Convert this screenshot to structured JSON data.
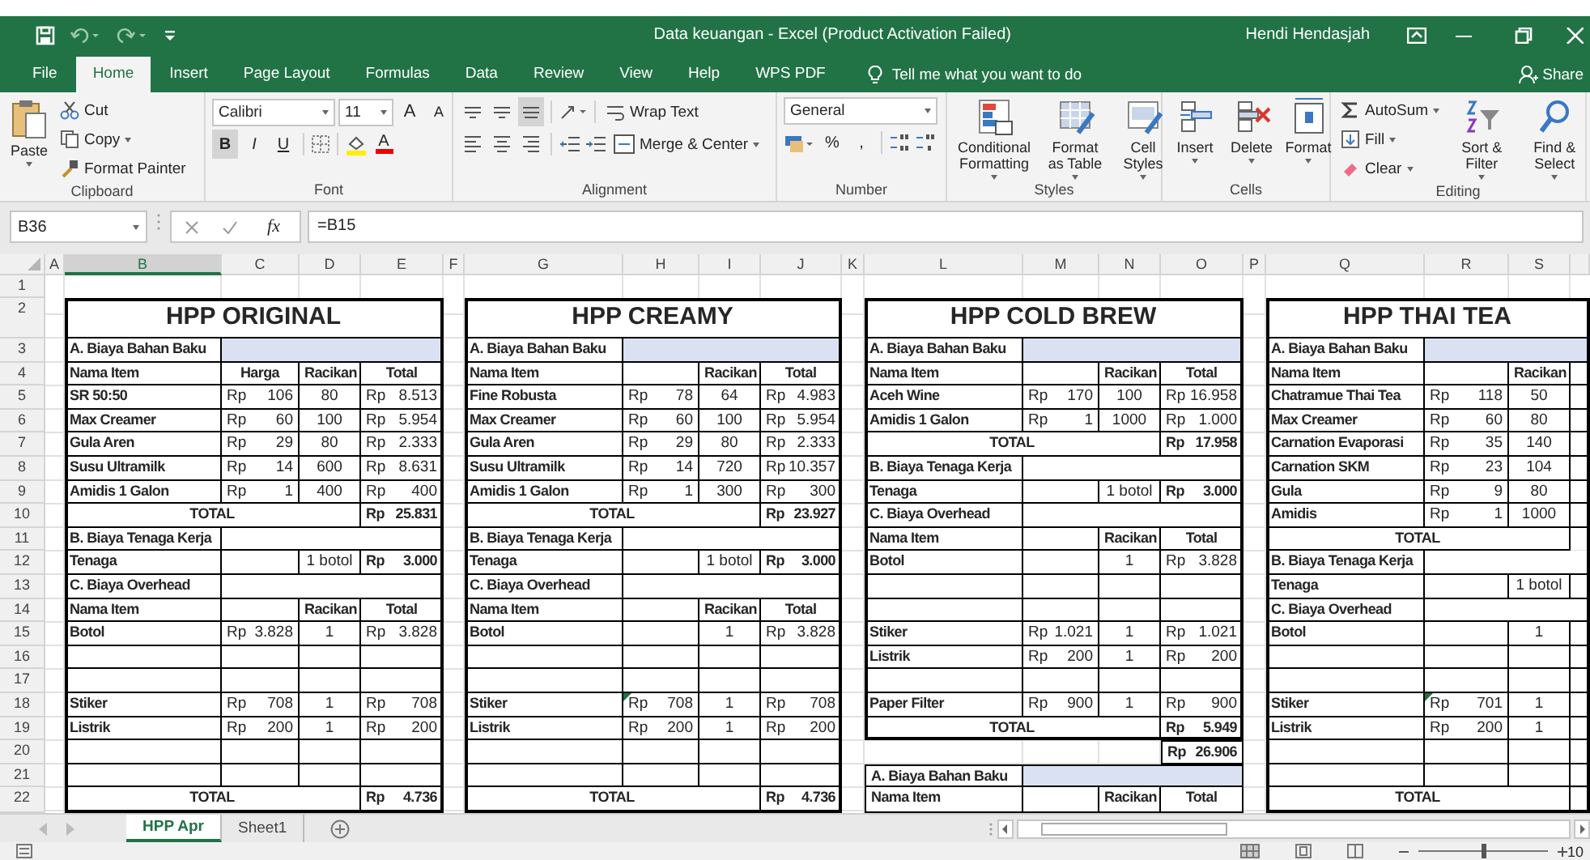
{
  "window": {
    "title": "Data keuangan - Excel (Product Activation Failed)",
    "user": "Hendi Hendasjah"
  },
  "tabs": [
    {
      "label": "File",
      "selected": false
    },
    {
      "label": "Home",
      "selected": true
    },
    {
      "label": "Insert",
      "selected": false
    },
    {
      "label": "Page Layout",
      "selected": false
    },
    {
      "label": "Formulas",
      "selected": false
    },
    {
      "label": "Data",
      "selected": false
    },
    {
      "label": "Review",
      "selected": false
    },
    {
      "label": "View",
      "selected": false
    },
    {
      "label": "Help",
      "selected": false
    },
    {
      "label": "WPS PDF",
      "selected": false
    }
  ],
  "tell_me": "Tell me what you want to do",
  "share": "Share",
  "ribbon": [
    {
      "kind": "clipboard",
      "label": "Clipboard",
      "paste": "Paste",
      "items": [
        "Cut",
        "Copy",
        "Format Painter"
      ]
    },
    {
      "kind": "font",
      "label": "Font",
      "font": "Calibri",
      "size": "11",
      "grow": [
        "A",
        "A"
      ],
      "styles": [
        {
          "label": "B",
          "selected": true
        },
        {
          "label": "I",
          "selected": false
        },
        {
          "label": "U",
          "selected": false
        }
      ],
      "color_label": "A"
    },
    {
      "kind": "alignment",
      "label": "Alignment",
      "aligns": [
        {
          "kind": "top",
          "selected": false
        },
        {
          "kind": "middle",
          "selected": false
        },
        {
          "kind": "bottom",
          "selected": true
        },
        {
          "kind": "left",
          "selected": false
        },
        {
          "kind": "center",
          "selected": false
        },
        {
          "kind": "right",
          "selected": false
        }
      ],
      "items": [
        "Wrap Text",
        "Merge & Center"
      ]
    },
    {
      "kind": "number",
      "label": "Number",
      "format": "General",
      "symbols": [
        "%",
        ","
      ]
    },
    {
      "kind": "styles",
      "label": "Styles",
      "items": [
        "Conditional Formatting",
        "Format as Table",
        "Cell Styles"
      ]
    },
    {
      "kind": "cells",
      "label": "Cells",
      "items": [
        "Insert",
        "Delete",
        "Format"
      ]
    },
    {
      "kind": "editing",
      "label": "Editing",
      "small": [
        "AutoSum",
        "Fill",
        "Clear"
      ],
      "big": [
        "Sort & Filter",
        "Find & Select"
      ]
    }
  ],
  "formula_bar": {
    "name_box": "B36",
    "function_label": "fx",
    "formula": "=B15"
  },
  "sheet": {
    "columns": [
      {
        "label": "A",
        "selected": false
      },
      {
        "label": "B",
        "selected": true
      },
      {
        "label": "C",
        "selected": false
      },
      {
        "label": "D",
        "selected": false
      },
      {
        "label": "E",
        "selected": false
      },
      {
        "label": "F",
        "selected": false
      },
      {
        "label": "G",
        "selected": false
      },
      {
        "label": "H",
        "selected": false
      },
      {
        "label": "I",
        "selected": false
      },
      {
        "label": "J",
        "selected": false
      },
      {
        "label": "K",
        "selected": false
      },
      {
        "label": "L",
        "selected": false
      },
      {
        "label": "M",
        "selected": false
      },
      {
        "label": "N",
        "selected": false
      },
      {
        "label": "O",
        "selected": false
      },
      {
        "label": "P",
        "selected": false
      },
      {
        "label": "Q",
        "selected": false
      },
      {
        "label": "R",
        "selected": false
      },
      {
        "label": "S",
        "selected": false
      }
    ],
    "row_numbers": [
      "1",
      "2",
      "3",
      "4",
      "5",
      "6",
      "7",
      "8",
      "9",
      "10",
      "11",
      "12",
      "13",
      "14",
      "15",
      "16",
      "17",
      "18",
      "19",
      "20",
      "21",
      "22"
    ],
    "blocks": [
      {
        "title": "HPP ORIGINAL",
        "rows": [
          {
            "kind": "section",
            "label": "A. Biaya Bahan Baku",
            "shaded": true
          },
          {
            "kind": "columns",
            "cells": [
              "Nama Item",
              "Harga",
              "Racikan",
              "Total"
            ]
          },
          {
            "kind": "item",
            "cells": [
              "SR 50:50",
              [
                "Rp",
                "106"
              ],
              "80",
              [
                "Rp",
                "8.513"
              ]
            ]
          },
          {
            "kind": "item",
            "cells": [
              "Max Creamer",
              [
                "Rp",
                "60"
              ],
              "100",
              [
                "Rp",
                "5.954"
              ]
            ]
          },
          {
            "kind": "item",
            "cells": [
              "Gula Aren",
              [
                "Rp",
                "29"
              ],
              "80",
              [
                "Rp",
                "2.333"
              ]
            ]
          },
          {
            "kind": "item",
            "cells": [
              "Susu Ultramilk",
              [
                "Rp",
                "14"
              ],
              "600",
              [
                "Rp",
                "8.631"
              ]
            ]
          },
          {
            "kind": "item",
            "cells": [
              "Amidis 1 Galon",
              [
                "Rp",
                "1"
              ],
              "400",
              [
                "Rp",
                "400"
              ]
            ]
          },
          {
            "kind": "total",
            "label": "TOTAL",
            "value": [
              "Rp",
              "25.831"
            ]
          },
          {
            "kind": "section",
            "label": "B. Biaya Tenaga Kerja",
            "shaded": false
          },
          {
            "kind": "labor",
            "cells": [
              "Tenaga",
              null,
              "1 botol",
              [
                "Rp",
                "3.000"
              ]
            ]
          },
          {
            "kind": "section",
            "label": "C. Biaya Overhead",
            "shaded": false
          },
          {
            "kind": "columns",
            "cells": [
              "Nama Item",
              null,
              "Racikan",
              "Total"
            ]
          },
          {
            "kind": "item",
            "cells": [
              "Botol",
              [
                "Rp",
                "3.828"
              ],
              "1",
              [
                "Rp",
                "3.828"
              ]
            ]
          },
          {
            "kind": "blank"
          },
          {
            "kind": "blank"
          },
          {
            "kind": "item",
            "cells": [
              "Stiker",
              [
                "Rp",
                "708"
              ],
              "1",
              [
                "Rp",
                "708"
              ]
            ]
          },
          {
            "kind": "item",
            "cells": [
              "Listrik",
              [
                "Rp",
                "200"
              ],
              "1",
              [
                "Rp",
                "200"
              ]
            ]
          },
          {
            "kind": "blank"
          },
          {
            "kind": "blank"
          },
          {
            "kind": "total",
            "label": "TOTAL",
            "value": [
              "Rp",
              "4.736"
            ]
          }
        ]
      },
      {
        "title": "HPP CREAMY",
        "rows": [
          {
            "kind": "section",
            "label": "A. Biaya Bahan Baku",
            "shaded": true
          },
          {
            "kind": "columns",
            "cells": [
              "Nama Item",
              null,
              "Racikan",
              "Total"
            ]
          },
          {
            "kind": "item",
            "cells": [
              "Fine Robusta",
              [
                "Rp",
                "78"
              ],
              "64",
              [
                "Rp",
                "4.983"
              ]
            ]
          },
          {
            "kind": "item",
            "cells": [
              "Max Creamer",
              [
                "Rp",
                "60"
              ],
              "100",
              [
                "Rp",
                "5.954"
              ]
            ]
          },
          {
            "kind": "item",
            "cells": [
              "Gula Aren",
              [
                "Rp",
                "29"
              ],
              "80",
              [
                "Rp",
                "2.333"
              ]
            ]
          },
          {
            "kind": "item",
            "cells": [
              "Susu Ultramilk",
              [
                "Rp",
                "14"
              ],
              "720",
              [
                "Rp",
                "10.357"
              ]
            ]
          },
          {
            "kind": "item",
            "cells": [
              "Amidis 1 Galon",
              [
                "Rp",
                "1"
              ],
              "300",
              [
                "Rp",
                "300"
              ]
            ]
          },
          {
            "kind": "total",
            "label": "TOTAL",
            "value": [
              "Rp",
              "23.927"
            ]
          },
          {
            "kind": "section",
            "label": "B. Biaya Tenaga Kerja",
            "shaded": false
          },
          {
            "kind": "labor",
            "cells": [
              "Tenaga",
              null,
              "1 botol",
              [
                "Rp",
                "3.000"
              ]
            ]
          },
          {
            "kind": "section",
            "label": "C. Biaya Overhead",
            "shaded": false
          },
          {
            "kind": "columns",
            "cells": [
              "Nama Item",
              null,
              "Racikan",
              "Total"
            ]
          },
          {
            "kind": "item",
            "cells": [
              "Botol",
              null,
              "1",
              [
                "Rp",
                "3.828"
              ]
            ]
          },
          {
            "kind": "blank"
          },
          {
            "kind": "blank"
          },
          {
            "kind": "item",
            "warning": true,
            "cells": [
              "Stiker",
              [
                "Rp",
                "708"
              ],
              "1",
              [
                "Rp",
                "708"
              ]
            ]
          },
          {
            "kind": "item",
            "cells": [
              "Listrik",
              [
                "Rp",
                "200"
              ],
              "1",
              [
                "Rp",
                "200"
              ]
            ]
          },
          {
            "kind": "blank"
          },
          {
            "kind": "blank"
          },
          {
            "kind": "total",
            "label": "TOTAL",
            "value": [
              "Rp",
              "4.736"
            ]
          }
        ]
      },
      {
        "title": "HPP COLD BREW",
        "rows": [
          {
            "kind": "section",
            "label": "A. Biaya Bahan Baku",
            "shaded": true
          },
          {
            "kind": "columns",
            "cells": [
              "Nama Item",
              null,
              "Racikan",
              "Total"
            ]
          },
          {
            "kind": "item",
            "cells": [
              "Aceh Wine",
              [
                "Rp",
                "170"
              ],
              "100",
              [
                "Rp",
                "16.958"
              ]
            ]
          },
          {
            "kind": "item",
            "cells": [
              "Amidis 1 Galon",
              [
                "Rp",
                "1"
              ],
              "1000",
              [
                "Rp",
                "1.000"
              ]
            ]
          },
          {
            "kind": "total",
            "label": "TOTAL",
            "value": [
              "Rp",
              "17.958"
            ]
          },
          {
            "kind": "section",
            "label": "B. Biaya Tenaga Kerja",
            "shaded": false
          },
          {
            "kind": "labor",
            "cells": [
              "Tenaga",
              null,
              "1 botol",
              [
                "Rp",
                "3.000"
              ]
            ]
          },
          {
            "kind": "section",
            "label": "C. Biaya Overhead",
            "shaded": false
          },
          {
            "kind": "columns",
            "cells": [
              "Nama Item",
              null,
              "Racikan",
              "Total"
            ]
          },
          {
            "kind": "item",
            "cells": [
              "Botol",
              null,
              "1",
              [
                "Rp",
                "3.828"
              ]
            ]
          },
          {
            "kind": "blank"
          },
          {
            "kind": "blank"
          },
          {
            "kind": "item",
            "cells": [
              "Stiker",
              [
                "Rp",
                "1.021"
              ],
              "1",
              [
                "Rp",
                "1.021"
              ]
            ]
          },
          {
            "kind": "item",
            "cells": [
              "Listrik",
              [
                "Rp",
                "200"
              ],
              "1",
              [
                "Rp",
                "200"
              ]
            ]
          },
          {
            "kind": "blank"
          },
          {
            "kind": "item",
            "cells": [
              "Paper Filter",
              [
                "Rp",
                "900"
              ],
              "1",
              [
                "Rp",
                "900"
              ]
            ]
          },
          {
            "kind": "total",
            "label": "TOTAL",
            "value": [
              "Rp",
              "5.949"
            ]
          },
          {
            "kind": "grand",
            "value": [
              "Rp",
              "26.906"
            ]
          },
          {
            "kind": "section",
            "label": "A. Biaya Bahan Baku",
            "shaded": true
          },
          {
            "kind": "columns",
            "cells": [
              "Nama Item",
              null,
              "Racikan",
              "Total"
            ]
          }
        ]
      },
      {
        "title": "HPP THAI TEA",
        "rows": [
          {
            "kind": "section",
            "label": "A. Biaya Bahan Baku",
            "shaded": true
          },
          {
            "kind": "columns",
            "cells": [
              "Nama Item",
              null,
              "Racikan"
            ]
          },
          {
            "kind": "item",
            "cells": [
              "Chatramue Thai Tea",
              [
                "Rp",
                "118"
              ],
              "50"
            ]
          },
          {
            "kind": "item",
            "cells": [
              "Max Creamer",
              [
                "Rp",
                "60"
              ],
              "80"
            ]
          },
          {
            "kind": "item",
            "cells": [
              "Carnation Evaporasi",
              [
                "Rp",
                "35"
              ],
              "140"
            ]
          },
          {
            "kind": "item",
            "cells": [
              "Carnation SKM",
              [
                "Rp",
                "23"
              ],
              "104"
            ]
          },
          {
            "kind": "item",
            "cells": [
              "Gula",
              [
                "Rp",
                "9"
              ],
              "80"
            ]
          },
          {
            "kind": "item",
            "cells": [
              "Amidis",
              [
                "Rp",
                "1"
              ],
              "1000"
            ]
          },
          {
            "kind": "total",
            "label": "TOTAL"
          },
          {
            "kind": "section",
            "label": "B. Biaya Tenaga Kerja",
            "shaded": false
          },
          {
            "kind": "labor",
            "cells": [
              "Tenaga",
              null,
              "1 botol"
            ]
          },
          {
            "kind": "section",
            "label": "C. Biaya Overhead",
            "shaded": false
          },
          {
            "kind": "item",
            "cells": [
              "Botol",
              null,
              "1"
            ]
          },
          {
            "kind": "blank"
          },
          {
            "kind": "blank"
          },
          {
            "kind": "item",
            "warning": true,
            "cells": [
              "Stiker",
              [
                "Rp",
                "701"
              ],
              "1"
            ]
          },
          {
            "kind": "item",
            "cells": [
              "Listrik",
              [
                "Rp",
                "200"
              ],
              "1"
            ]
          },
          {
            "kind": "blank"
          },
          {
            "kind": "blank"
          },
          {
            "kind": "total",
            "label": "TOTAL"
          }
        ]
      }
    ]
  },
  "sheet_tabs": [
    {
      "label": "HPP Apr",
      "selected": true
    },
    {
      "label": "Sheet1",
      "selected": false
    }
  ],
  "status_bar": {
    "zoom": {
      "level": 0.5,
      "reading": "10"
    }
  }
}
